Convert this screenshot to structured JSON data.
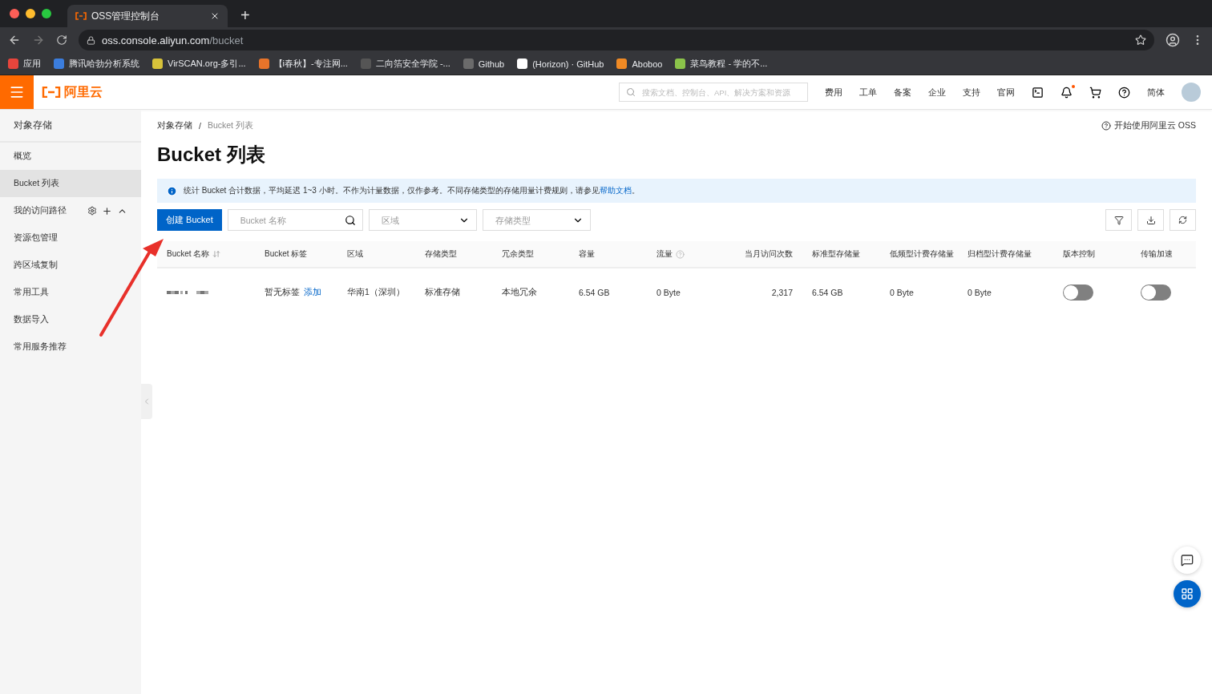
{
  "browser": {
    "tab_title": "OSS管理控制台",
    "new_tab": "+",
    "url_host": "oss.console.aliyun.com",
    "url_path": "/bucket",
    "bookmarks": [
      {
        "label": "应用",
        "color": "#e8453c"
      },
      {
        "label": "腾讯哈勃分析系统",
        "color": "#3b7ddd"
      },
      {
        "label": "VirSCAN.org-多引...",
        "color": "#d7c23a"
      },
      {
        "label": "【i春秋】-专注网...",
        "color": "#e8742a"
      },
      {
        "label": "二向箔安全学院 -...",
        "color": "#555555"
      },
      {
        "label": "Github",
        "color": "#6b6b6b"
      },
      {
        "label": "(Horizon) · GitHub",
        "color": "#ffffff"
      },
      {
        "label": "Aboboo",
        "color": "#f08a24"
      },
      {
        "label": "菜鸟教程 - 学的不...",
        "color": "#8bc34a"
      }
    ]
  },
  "header": {
    "logo": "阿里云",
    "search": {
      "placeholder": "搜索文档、控制台、API、解决方案和资源"
    },
    "nav": [
      "费用",
      "工单",
      "备案",
      "企业",
      "支持",
      "官网"
    ],
    "notification_dot": true,
    "language": "简体"
  },
  "sidebar": {
    "title": "对象存储",
    "items": [
      {
        "label": "概览",
        "selected": false,
        "kind": "link"
      },
      {
        "label": "Bucket 列表",
        "selected": true,
        "kind": "link"
      },
      {
        "label": "我的访问路径",
        "selected": false,
        "kind": "group"
      },
      {
        "label": "资源包管理",
        "selected": false,
        "kind": "link"
      },
      {
        "label": "跨区域复制",
        "selected": false,
        "kind": "link"
      },
      {
        "label": "常用工具",
        "selected": false,
        "kind": "link"
      },
      {
        "label": "数据导入",
        "selected": false,
        "kind": "link"
      },
      {
        "label": "常用服务推荐",
        "selected": false,
        "kind": "link"
      }
    ]
  },
  "breadcrumb": [
    "对象存储",
    "Bucket 列表"
  ],
  "breadcrumb_separator": "/",
  "help_link": "开始使用阿里云 OSS",
  "page_title": "Bucket 列表",
  "notice": {
    "text": "统计 Bucket 合计数据，平均延迟 1~3 小时。不作为计量数据，仅作参考。不同存储类型的存储用量计费规则，请参见",
    "link": "帮助文档",
    "end": "。"
  },
  "toolbar": {
    "create_button": "创建 Bucket",
    "name_search": {
      "placeholder": "Bucket 名称"
    },
    "region_select": {
      "placeholder": "区域"
    },
    "storage_select": {
      "placeholder": "存储类型"
    }
  },
  "table": {
    "columns": [
      {
        "label": "Bucket 名称",
        "kind": "sort"
      },
      {
        "label": "Bucket 标签",
        "kind": "text"
      },
      {
        "label": "区域",
        "kind": "text"
      },
      {
        "label": "存储类型",
        "kind": "text"
      },
      {
        "label": "冗余类型",
        "kind": "text"
      },
      {
        "label": "容量",
        "kind": "text"
      },
      {
        "label": "流量",
        "kind": "help"
      },
      {
        "label": "当月访问次数",
        "kind": "number"
      },
      {
        "label": "标准型存储量",
        "kind": "text"
      },
      {
        "label": "低频型计费存储量",
        "kind": "text"
      },
      {
        "label": "归档型计费存储量",
        "kind": "text"
      },
      {
        "label": "版本控制",
        "kind": "text"
      },
      {
        "label": "传输加速",
        "kind": "text"
      }
    ],
    "rows": [
      {
        "tag": "暂无标签",
        "tag_action": "添加",
        "region": "华南1（深圳）",
        "storage": "标准存储",
        "redundancy": "本地冗余",
        "capacity": "6.54 GB",
        "traffic": "0 Byte",
        "visits": "2,317",
        "standard": "6.54 GB",
        "infrequent": "0 Byte",
        "archive": "0 Byte",
        "versioning": {
          "on": false
        },
        "acceleration": {
          "on": false
        }
      }
    ]
  }
}
